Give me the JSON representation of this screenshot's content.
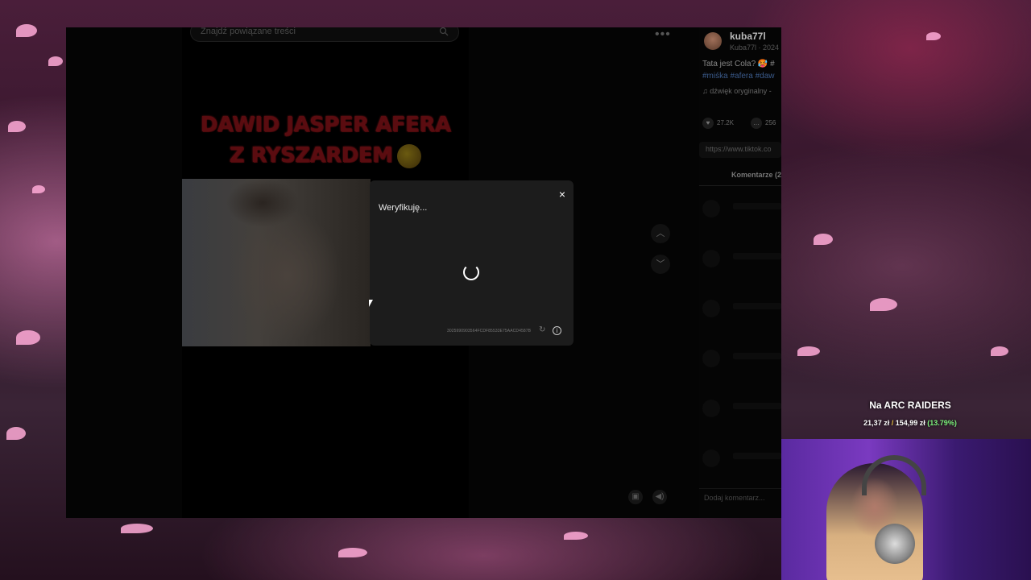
{
  "search": {
    "placeholder": "Znajdź powiązane treści"
  },
  "video": {
    "headline_line1": "DAWID JASPER AFERA",
    "headline_line2": "Z RYSZARDEM"
  },
  "verify_modal": {
    "title": "Weryfikuję...",
    "close_glyph": "×",
    "code": "3025990903564FCDF85533E75AACD4587B",
    "info_glyph": "i",
    "refresh_glyph": "↻"
  },
  "nav": {
    "up_glyph": "︿",
    "down_glyph": "﹀"
  },
  "author": {
    "name": "kuba77l",
    "sub": "Kuba77l · 2024",
    "description": "Tata jest Cola? 🥵 #",
    "tags": "#miśka #afera #daw",
    "sound": "♫  dźwięk oryginalny -"
  },
  "stats": {
    "likes": "27.2K",
    "comments": "256"
  },
  "share": {
    "link": "https://www.tiktok.co"
  },
  "comments": {
    "tab_label": "Komentarze (2",
    "input_placeholder": "Dodaj komentarz..."
  },
  "stream_overlay": {
    "goal_title": "Na ARC RAIDERS",
    "goal_current": "21,37 zł",
    "goal_separator": "/",
    "goal_target": "154,99 zł",
    "goal_percent": "(13.79%)",
    "progress": 0.1379
  },
  "colors": {
    "modal_bg": "#1c1c1c",
    "headline": "#5a0c10",
    "goal_percent": "#7cf07c",
    "tag_link": "#3a5a8a"
  }
}
